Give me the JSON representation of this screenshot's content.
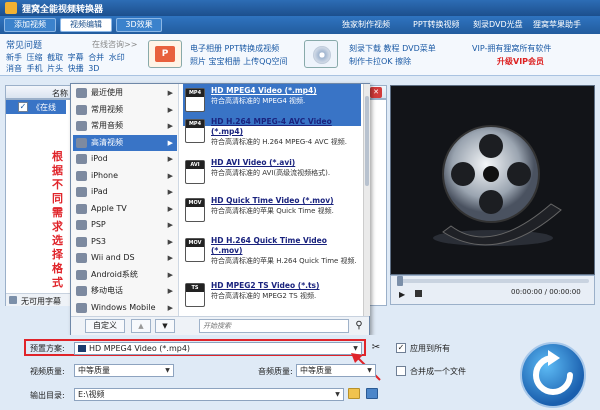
{
  "app": {
    "title": "狸窝全能视频转换器"
  },
  "tabs": [
    {
      "label": "添加视频"
    },
    {
      "label": "视频编辑"
    },
    {
      "label": "3D效果"
    }
  ],
  "toplinks": [
    "独家制作视频",
    "PPT转换视频",
    "刻录DVD光盘",
    "狸窝苹果助手"
  ],
  "faq": {
    "title": "常见问题",
    "online": "在线咨询>>",
    "row1": [
      "新手",
      "压缩",
      "截取",
      "字幕",
      "合并",
      "水印"
    ],
    "row2": [
      "消音",
      "手机",
      "片头",
      "快播",
      "3D"
    ]
  },
  "promo": {
    "col1a": "电子相册",
    "col1b": "PPT转换成视频",
    "col1c": "照片",
    "col1d": "宝宝相册",
    "col1e": "上传QQ空间",
    "col2a": "刻录下载",
    "col2b": "教程",
    "col2c": "DVD菜单",
    "col2d": "制作卡拉OK",
    "col2e": "擦除",
    "vip": "VIP-拥有狸窝所有软件",
    "vipupgrade": "升级VIP会员"
  },
  "list": {
    "name_header": "名称",
    "item": "《在线"
  },
  "annotation": "根据不同需求选择格式",
  "nosubs": "无可用字幕",
  "menu": {
    "categories": [
      {
        "label": "最近使用"
      },
      {
        "label": "常用视频"
      },
      {
        "label": "常用音频"
      },
      {
        "label": "高清视频"
      },
      {
        "label": "iPod"
      },
      {
        "label": "iPhone"
      },
      {
        "label": "iPad"
      },
      {
        "label": "Apple TV"
      },
      {
        "label": "PSP"
      },
      {
        "label": "PS3"
      },
      {
        "label": "Wii and DS"
      },
      {
        "label": "Android系统"
      },
      {
        "label": "移动电话"
      },
      {
        "label": "Windows Mobile"
      }
    ],
    "formats": [
      {
        "tag": "MP4",
        "name": "HD MPEG4 Video (*.mp4)",
        "desc": "符合高清标准的 MPEG4 视频."
      },
      {
        "tag": "MP4",
        "name": "HD H.264 MPEG-4 AVC Video (*.mp4)",
        "desc": "符合高清标准的 H.264 MPEG-4 AVC 视频."
      },
      {
        "tag": "AVI",
        "name": "HD AVI Video (*.avi)",
        "desc": "符合高清标准的 AVI(高级流视频格式)."
      },
      {
        "tag": "MOV",
        "name": "HD Quick Time Video (*.mov)",
        "desc": "符合高清标准的苹果 Quick Time 视频."
      },
      {
        "tag": "MOV",
        "name": "HD H.264 Quick Time Video (*.mov)",
        "desc": "符合高清标准的苹果 H.264 Quick Time 视频."
      },
      {
        "tag": "TS",
        "name": "HD MPEG2 TS Video (*.ts)",
        "desc": "符合高清标准的 MPEG2 TS 视频."
      }
    ],
    "custom": "自定义",
    "search_placeholder": "开始搜索"
  },
  "time": "00:00:00 / 00:00:00",
  "bottom": {
    "preset_label": "预置方案:",
    "preset_value": "HD MPEG4 Video (*.mp4)",
    "apply_all": "应用到所有",
    "video_quality_label": "视频质量:",
    "video_quality": "中等质量",
    "audio_quality_label": "音频质量:",
    "audio_quality": "中等质量",
    "merge": "合并成一个文件",
    "output_label": "输出目录:",
    "output_value": "E:\\视频"
  },
  "colors": {
    "accent": "#3974c6",
    "red": "#d22"
  }
}
